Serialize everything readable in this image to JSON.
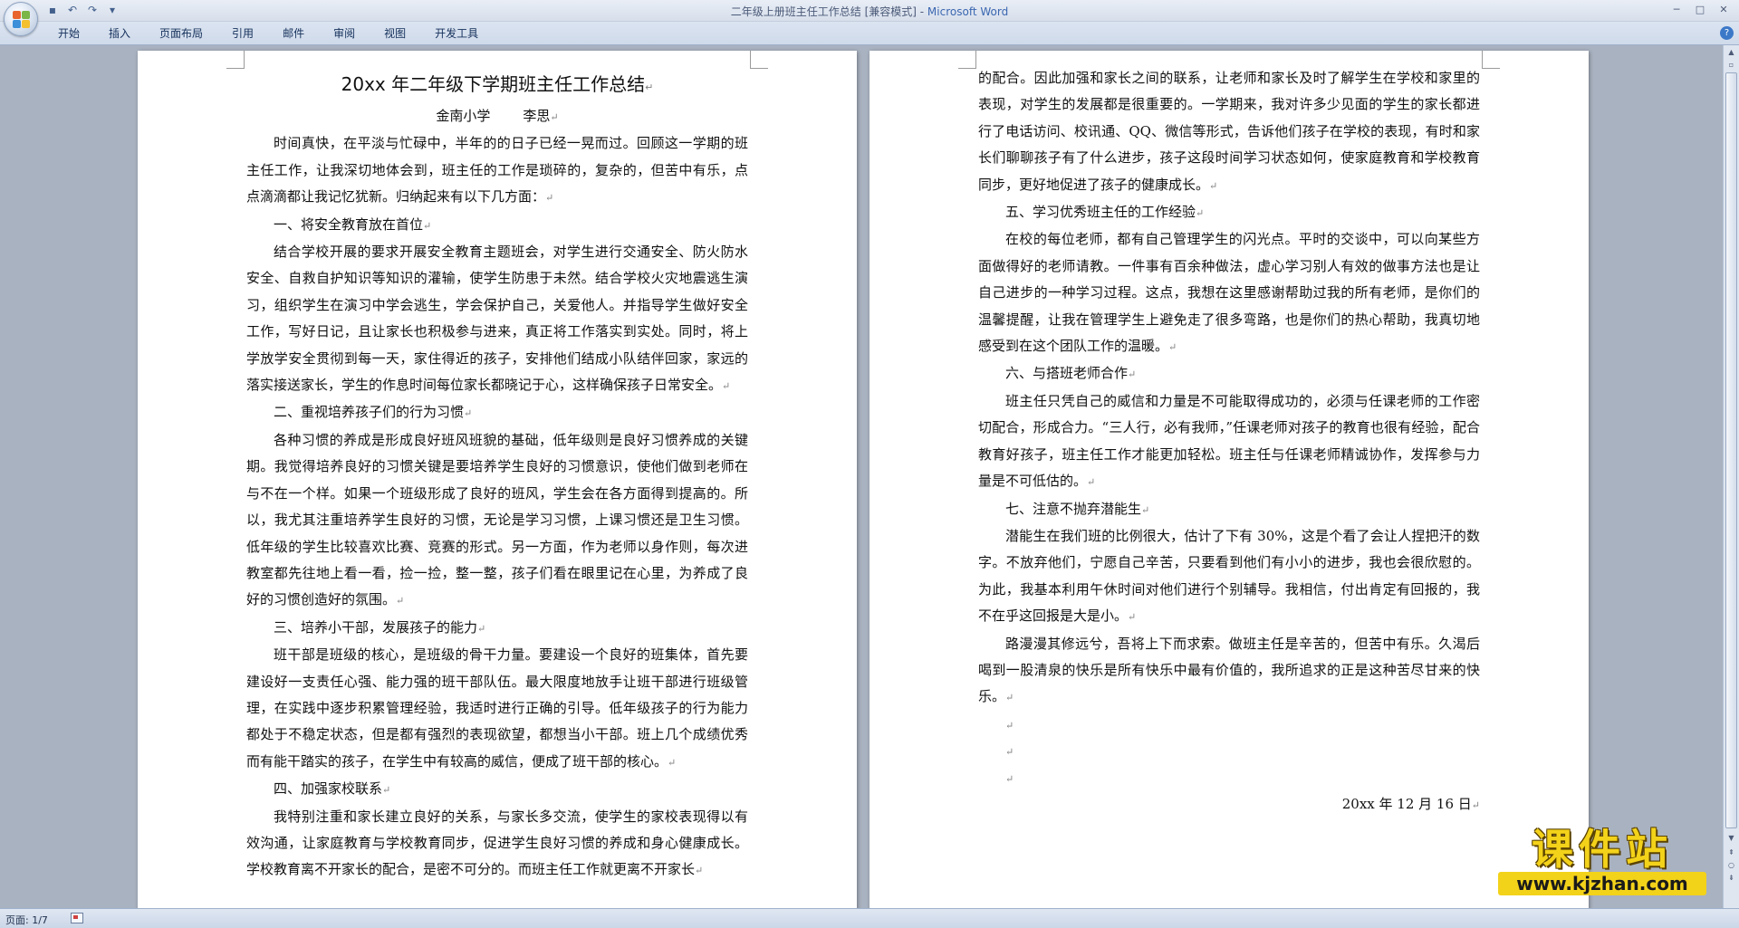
{
  "window": {
    "title_doc": "二年级上册班主任工作总结 [兼容模式] - ",
    "title_app": "Microsoft Word"
  },
  "ribbon": {
    "tabs": [
      "开始",
      "插入",
      "页面布局",
      "引用",
      "邮件",
      "审阅",
      "视图",
      "开发工具"
    ]
  },
  "page1": {
    "title": "20xx 年二年级下学期班主任工作总结",
    "school": "金南小学",
    "author": "李思",
    "paragraphs": [
      {
        "style": "indent",
        "text": "时间真快，在平淡与忙碌中，半年的的日子已经一晃而过。回顾这一学期的班主任工作，让我深切地体会到，班主任的工作是琐碎的，复杂的，但苦中有乐，点点滴滴都让我记忆犹新。归纳起来有以下几方面："
      },
      {
        "style": "heading",
        "text": "一、将安全教育放在首位"
      },
      {
        "style": "indent",
        "text": "结合学校开展的要求开展安全教育主题班会，对学生进行交通安全、防火防水安全、自救自护知识等知识的灌输，使学生防患于未然。结合学校火灾地震逃生演习，组织学生在演习中学会逃生，学会保护自己，关爱他人。并指导学生做好安全工作，写好日记，且让家长也积极参与进来，真正将工作落实到实处。同时，将上学放学安全贯彻到每一天，家住得近的孩子，安排他们结成小队结伴回家，家远的落实接送家长，学生的作息时间每位家长都晓记于心，这样确保孩子日常安全。"
      },
      {
        "style": "heading",
        "text": "二、重视培养孩子们的行为习惯"
      },
      {
        "style": "indent",
        "text": "各种习惯的养成是形成良好班风班貌的基础，低年级则是良好习惯养成的关键期。我觉得培养良好的习惯关键是要培养学生良好的习惯意识，使他们做到老师在与不在一个样。如果一个班级形成了良好的班风，学生会在各方面得到提高的。所以，我尤其注重培养学生良好的习惯，无论是学习习惯，上课习惯还是卫生习惯。低年级的学生比较喜欢比赛、竞赛的形式。另一方面，作为老师以身作则，每次进教室都先往地上看一看，捡一捡，整一整，孩子们看在眼里记在心里，为养成了良好的习惯创造好的氛围。"
      },
      {
        "style": "heading",
        "text": "三、培养小干部，发展孩子的能力"
      },
      {
        "style": "indent",
        "text": "班干部是班级的核心，是班级的骨干力量。要建设一个良好的班集体，首先要建设好一支责任心强、能力强的班干部队伍。最大限度地放手让班干部进行班级管理，在实践中逐步积累管理经验，我适时进行正确的引导。低年级孩子的行为能力都处于不稳定状态，但是都有强烈的表现欲望，都想当小干部。班上几个成绩优秀而有能干踏实的孩子，在学生中有较高的威信，便成了班干部的核心。"
      },
      {
        "style": "heading",
        "text": "四、加强家校联系"
      },
      {
        "style": "indent",
        "text": "我特别注重和家长建立良好的关系，与家长多交流，使学生的家校表现得以有效沟通，让家庭教育与学校教育同步，促进学生良好习惯的养成和身心健康成长。学校教育离不开家长的配合，是密不可分的。而班主任工作就更离不开家长"
      }
    ]
  },
  "page2": {
    "paragraphs": [
      {
        "style": "plain",
        "text": "的配合。因此加强和家长之间的联系，让老师和家长及时了解学生在学校和家里的表现，对学生的发展都是很重要的。一学期来，我对许多少见面的学生的家长都进行了电话访问、校讯通、QQ、微信等形式，告诉他们孩子在学校的表现，有时和家长们聊聊孩子有了什么进步，孩子这段时间学习状态如何，使家庭教育和学校教育同步，更好地促进了孩子的健康成长。"
      },
      {
        "style": "heading",
        "text": "五、学习优秀班主任的工作经验"
      },
      {
        "style": "indent",
        "text": "在校的每位老师，都有自己管理学生的闪光点。平时的交谈中，可以向某些方面做得好的老师请教。一件事有百余种做法，虚心学习别人有效的做事方法也是让自己进步的一种学习过程。这点，我想在这里感谢帮助过我的所有老师，是你们的温馨提醒，让我在管理学生上避免走了很多弯路，也是你们的热心帮助，我真切地感受到在这个团队工作的温暖。"
      },
      {
        "style": "heading",
        "text": "六、与搭班老师合作"
      },
      {
        "style": "indent",
        "text": "班主任只凭自己的威信和力量是不可能取得成功的，必须与任课老师的工作密切配合，形成合力。“三人行，必有我师，”任课老师对孩子的教育也很有经验，配合教育好孩子，班主任工作才能更加轻松。班主任与任课老师精诚协作，发挥参与力量是不可低估的。"
      },
      {
        "style": "heading",
        "text": "七、注意不抛弃潜能生"
      },
      {
        "style": "indent",
        "text": "潜能生在我们班的比例很大，估计了下有 30%，这是个看了会让人捏把汗的数字。不放弃他们，宁愿自己辛苦，只要看到他们有小小的进步，我也会很欣慰的。为此，我基本利用午休时间对他们进行个别辅导。我相信，付出肯定有回报的，我不在乎这回报是大是小。"
      },
      {
        "style": "indent",
        "text": "路漫漫其修远兮，吾将上下而求索。做班主任是辛苦的，但苦中有乐。久渴后喝到一股清泉的快乐是所有快乐中最有价值的，我所追求的正是这种苦尽甘来的快乐。"
      },
      {
        "style": "blank",
        "text": ""
      },
      {
        "style": "blank",
        "text": ""
      },
      {
        "style": "blank",
        "text": ""
      },
      {
        "style": "date",
        "text": "20xx 年 12 月 16 日"
      }
    ]
  },
  "marks": {
    "paragraph": "↵"
  },
  "status": {
    "page": "页面: 1/7"
  },
  "watermark": {
    "main": "课件站",
    "url": "www.kjzhan.com"
  },
  "colors": {
    "title_app": "#3b67b0",
    "workspace": "#a9b2c0",
    "watermark_yellow": "#f3d21a"
  }
}
